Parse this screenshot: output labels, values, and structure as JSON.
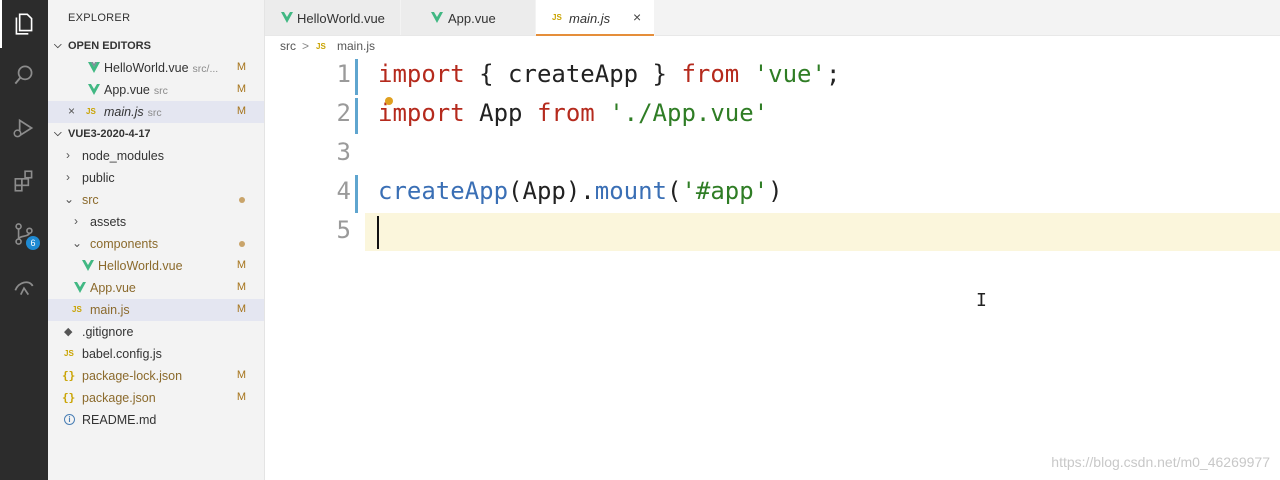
{
  "activity_bar": {
    "icons": [
      "files-icon",
      "search-icon",
      "run-debug-icon",
      "extensions-icon",
      "source-control-icon",
      "remote-icon"
    ],
    "source_control_badge": "6"
  },
  "sidebar": {
    "title": "EXPLORER",
    "open_editors": {
      "header": "OPEN EDITORS",
      "items": [
        {
          "name": "HelloWorld.vue",
          "path": "src/...",
          "status": "M"
        },
        {
          "name": "App.vue",
          "path": "src",
          "status": "M"
        },
        {
          "name": "main.js",
          "path": "src",
          "status": "M"
        }
      ]
    },
    "project": {
      "header": "VUE3-2020-4-17",
      "items": [
        {
          "name": "node_modules",
          "status": ""
        },
        {
          "name": "public",
          "status": ""
        },
        {
          "name": "src",
          "status": ""
        },
        {
          "name": "assets",
          "status": ""
        },
        {
          "name": "components",
          "status": ""
        },
        {
          "name": "HelloWorld.vue",
          "status": "M"
        },
        {
          "name": "App.vue",
          "status": "M"
        },
        {
          "name": "main.js",
          "status": "M"
        },
        {
          "name": ".gitignore",
          "status": ""
        },
        {
          "name": "babel.config.js",
          "status": ""
        },
        {
          "name": "package-lock.json",
          "status": "M"
        },
        {
          "name": "package.json",
          "status": "M"
        },
        {
          "name": "README.md",
          "status": ""
        }
      ]
    }
  },
  "tabs": [
    {
      "label": "HelloWorld.vue",
      "icon": "vue"
    },
    {
      "label": "App.vue",
      "icon": "vue"
    },
    {
      "label": "main.js",
      "icon": "js",
      "close": "×"
    }
  ],
  "breadcrumb": {
    "folder": "src",
    "separator": ">",
    "file": "main.js",
    "file_icon": "JS"
  },
  "editor": {
    "line_numbers": [
      "1",
      "2",
      "3",
      "4",
      "5"
    ],
    "lines": [
      [
        {
          "t": "import",
          "c": "kw"
        },
        {
          "t": " { createApp } ",
          "c": ""
        },
        {
          "t": "from",
          "c": "kw"
        },
        {
          "t": " ",
          "c": ""
        },
        {
          "t": "'vue'",
          "c": "str"
        },
        {
          "t": ";",
          "c": ""
        }
      ],
      [
        {
          "t": "import",
          "c": "kw"
        },
        {
          "t": " App ",
          "c": ""
        },
        {
          "t": "from",
          "c": "kw"
        },
        {
          "t": " ",
          "c": ""
        },
        {
          "t": "'./App.vue'",
          "c": "str"
        }
      ],
      [],
      [
        {
          "t": "createApp",
          "c": "fn"
        },
        {
          "t": "(App).",
          "c": ""
        },
        {
          "t": "mount",
          "c": "fn"
        },
        {
          "t": "(",
          "c": ""
        },
        {
          "t": "'#app'",
          "c": "str"
        },
        {
          "t": ")",
          "c": ""
        }
      ],
      []
    ]
  },
  "watermark": "https://blog.csdn.net/m0_46269977",
  "colors": {
    "accent_tab": "#e58e3a",
    "vue_green": "#41b883",
    "modified": "#a6741b"
  }
}
